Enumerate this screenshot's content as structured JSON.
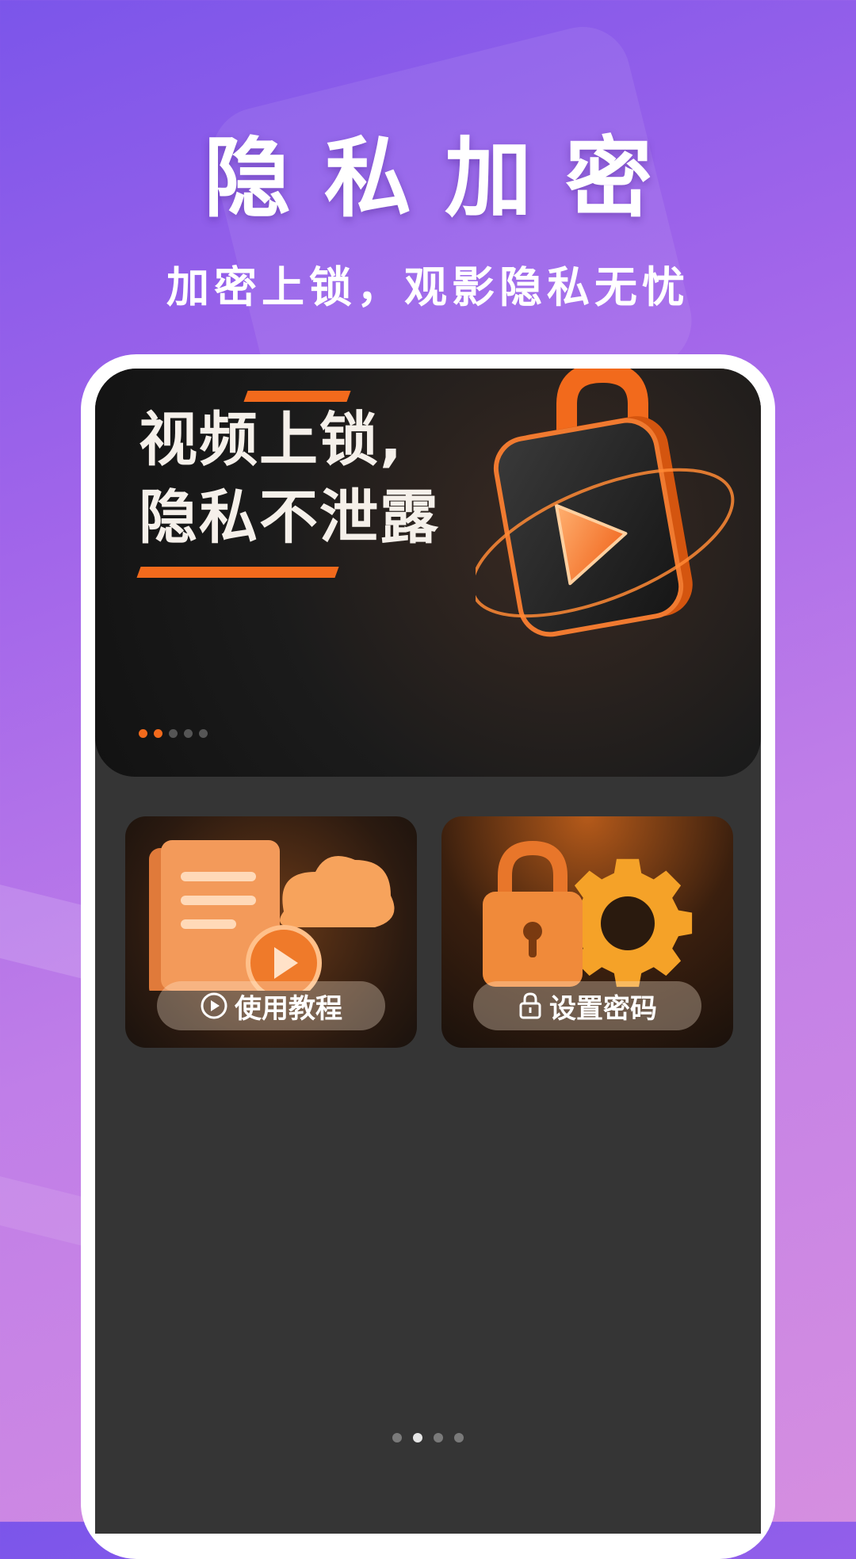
{
  "hero": {
    "title": "隐私加密",
    "subtitle": "加密上锁，观影隐私无忧"
  },
  "banner": {
    "line1": "视频上锁,",
    "line2": "隐私不泄露",
    "dots": 5,
    "active_dot": 1,
    "accent": "#f26a1c"
  },
  "cards": [
    {
      "label": "使用教程",
      "icon": "play-circle-icon"
    },
    {
      "label": "设置密码",
      "icon": "lock-icon"
    }
  ],
  "pager": {
    "count": 4,
    "active": 1
  },
  "colors": {
    "bg_start": "#7b55ea",
    "bg_end": "#d58ee0",
    "screen_bg": "#353535",
    "accent": "#f26a1c"
  }
}
